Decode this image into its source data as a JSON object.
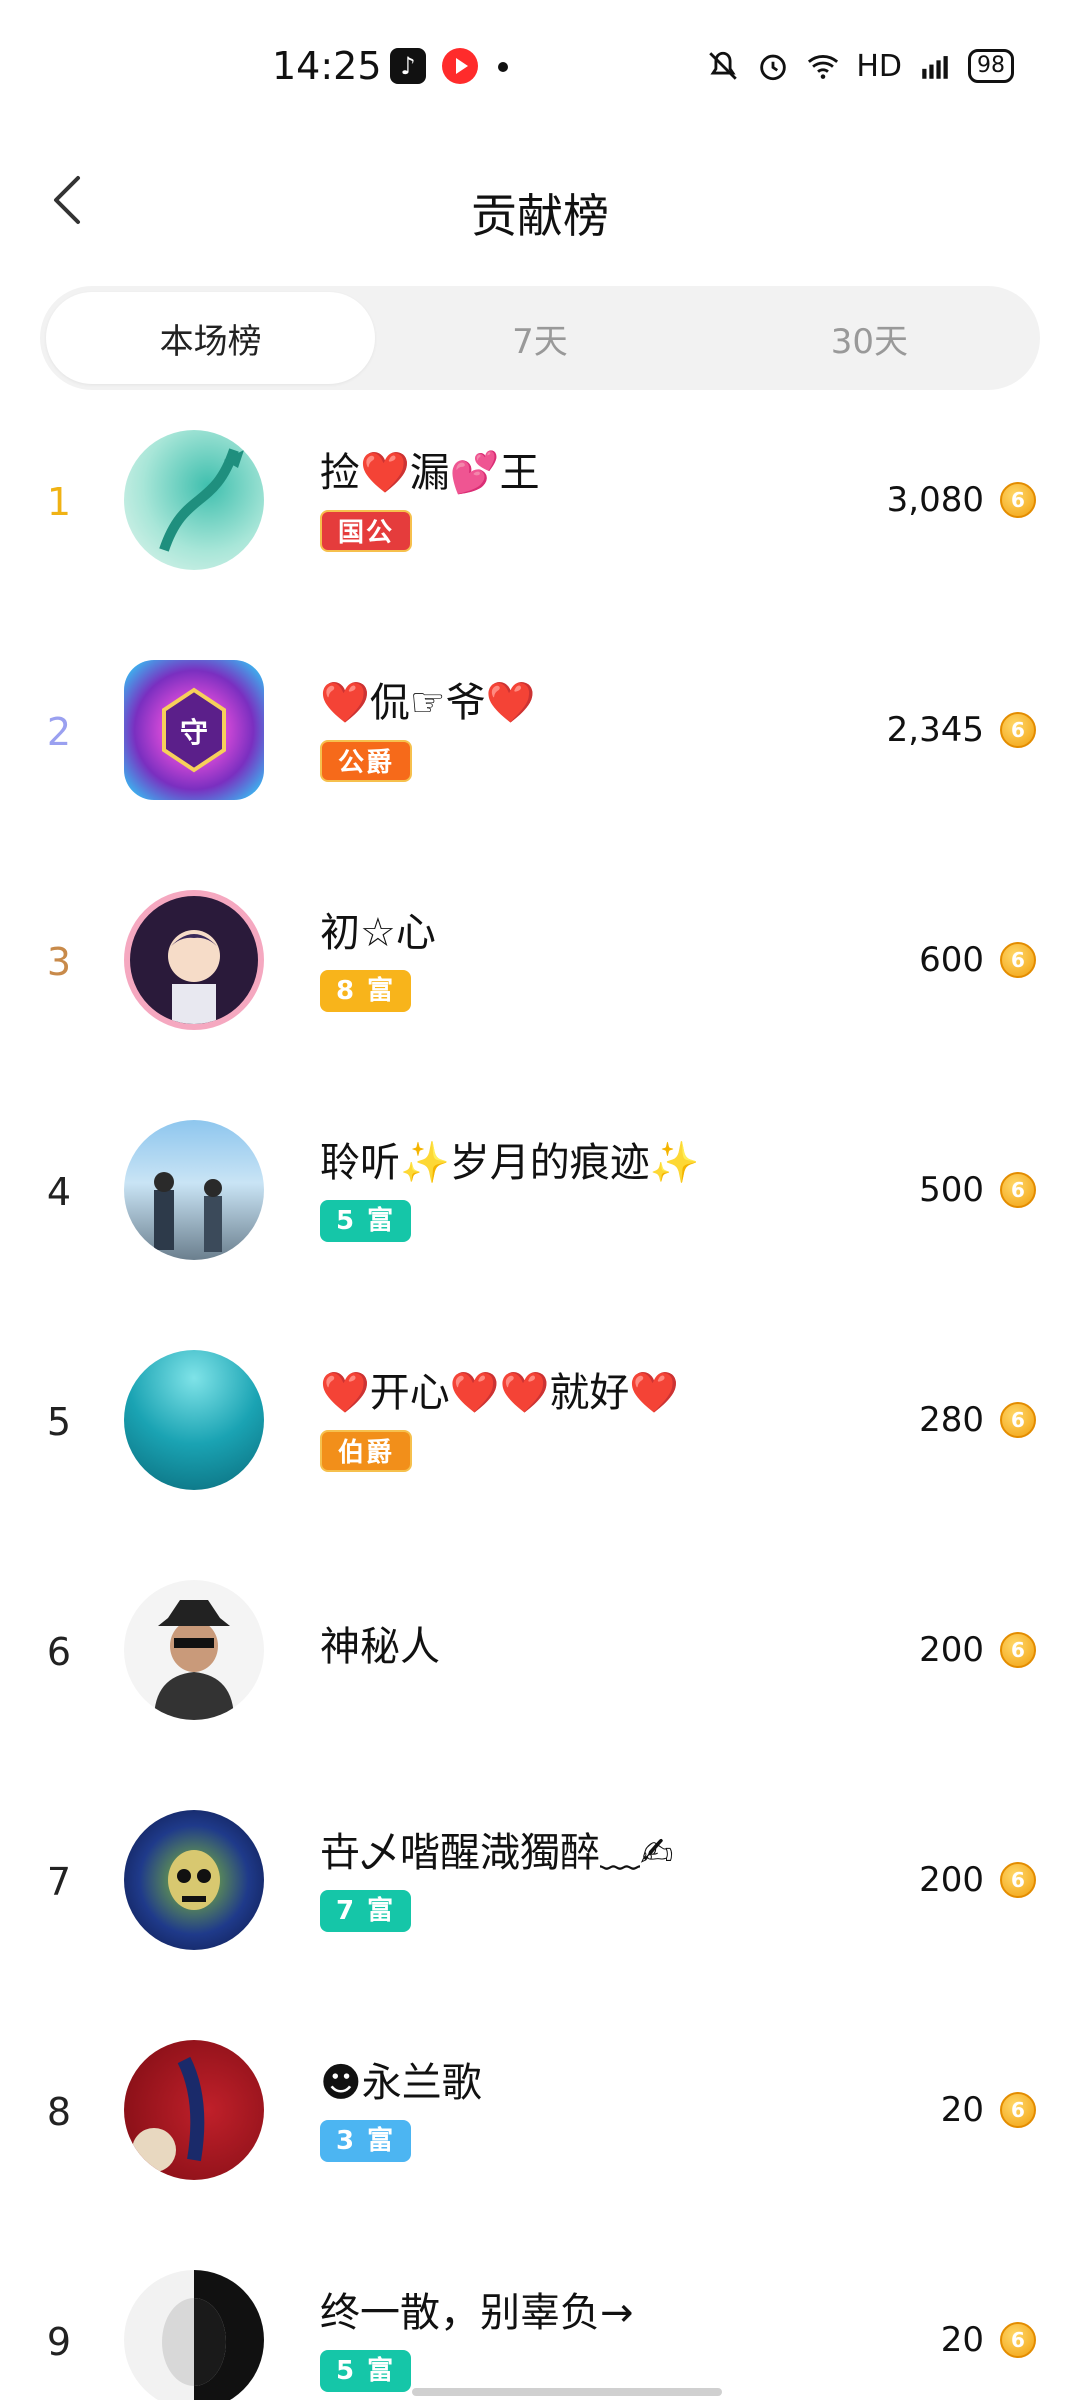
{
  "status_bar": {
    "time": "14:25",
    "battery": "98",
    "network": "HD",
    "signal": "4G"
  },
  "header": {
    "title": "贡献榜"
  },
  "tabs": [
    {
      "label": "本场榜",
      "active": true
    },
    {
      "label": "7天",
      "active": false
    },
    {
      "label": "30天",
      "active": false
    }
  ],
  "colors": {
    "rank1": "#f0b214",
    "rank2": "#9aa0f0",
    "rank3": "#c88a4a",
    "coin": "#f2a10f"
  },
  "list": [
    {
      "rank": "1",
      "name": "捡❤️漏💕王",
      "badge": "国公",
      "badge_style": "red",
      "score": "3,080"
    },
    {
      "rank": "2",
      "name": "❤️侃☞爷❤️",
      "badge": "公爵",
      "badge_style": "orange",
      "score": "2,345"
    },
    {
      "rank": "3",
      "name": "初☆心",
      "badge": "8 富",
      "badge_style": "yellow",
      "score": "600"
    },
    {
      "rank": "4",
      "name": "聆听✨岁月的痕迹✨",
      "badge": "5 富",
      "badge_style": "teal",
      "score": "500"
    },
    {
      "rank": "5",
      "name": "❤️开心❤️❤️就好❤️",
      "badge": "伯爵",
      "badge_style": "orange2",
      "score": "280"
    },
    {
      "rank": "6",
      "name": "神秘人",
      "badge": "",
      "badge_style": "",
      "score": "200"
    },
    {
      "rank": "7",
      "name": "卋乄喈醒渽獨醉﹏✍",
      "badge": "7 富",
      "badge_style": "teal",
      "score": "200"
    },
    {
      "rank": "8",
      "name": "☻永兰歌",
      "badge": "3 富",
      "badge_style": "blue",
      "score": "20"
    },
    {
      "rank": "9",
      "name": "终一散，别辜负→",
      "badge": "5 富",
      "badge_style": "teal",
      "score": "20"
    }
  ]
}
